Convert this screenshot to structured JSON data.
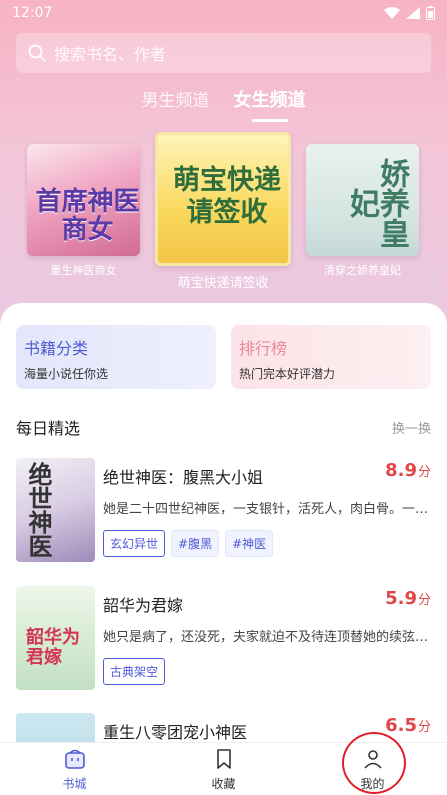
{
  "status_bar": {
    "time": "12:07"
  },
  "search": {
    "placeholder": "搜索书名、作者"
  },
  "channel_tabs": [
    {
      "label": "男生频道",
      "active": false
    },
    {
      "label": "女生频道",
      "active": true
    }
  ],
  "featured": [
    {
      "cover_title": "首席神医商女",
      "label": "重生神医商女"
    },
    {
      "cover_title": "萌宝快递请签收",
      "label": "萌宝快递请签收"
    },
    {
      "cover_title": "娇养皇妃",
      "label": "清穿之娇养皇妃"
    }
  ],
  "categories": [
    {
      "title": "书籍分类",
      "subtitle": "海量小说任你选"
    },
    {
      "title": "排行榜",
      "subtitle": "热门完本好评潜力"
    }
  ],
  "daily": {
    "title": "每日精选",
    "action": "换一换",
    "books": [
      {
        "cover_title": "绝世神医",
        "name": "绝世神医：腹黑大小姐",
        "score": "8.9",
        "unit": "分",
        "desc": "她是二十四世纪神医，一支银针，活死人，肉白骨。一…",
        "tags": [
          "玄幻异世",
          "#腹黑",
          "#神医"
        ]
      },
      {
        "cover_title": "韶华为君嫁",
        "name": "韶华为君嫁",
        "score": "5.9",
        "unit": "分",
        "desc": "她只是病了，还没死，夫家就迫不及待连顶替她的续弦…",
        "tags": [
          "古典架空"
        ]
      },
      {
        "name": "重生八零团宠小神医",
        "score": "6.5",
        "unit": "分"
      }
    ]
  },
  "bottom_nav": [
    {
      "label": "书城",
      "icon": "bookstore-icon",
      "active": true
    },
    {
      "label": "收藏",
      "icon": "bookmark-icon",
      "active": false
    },
    {
      "label": "我的",
      "icon": "profile-icon",
      "active": false
    }
  ],
  "colors": {
    "accent": "#4f5bd5",
    "score": "#e24646",
    "annotation_circle": "#e11f2a"
  }
}
